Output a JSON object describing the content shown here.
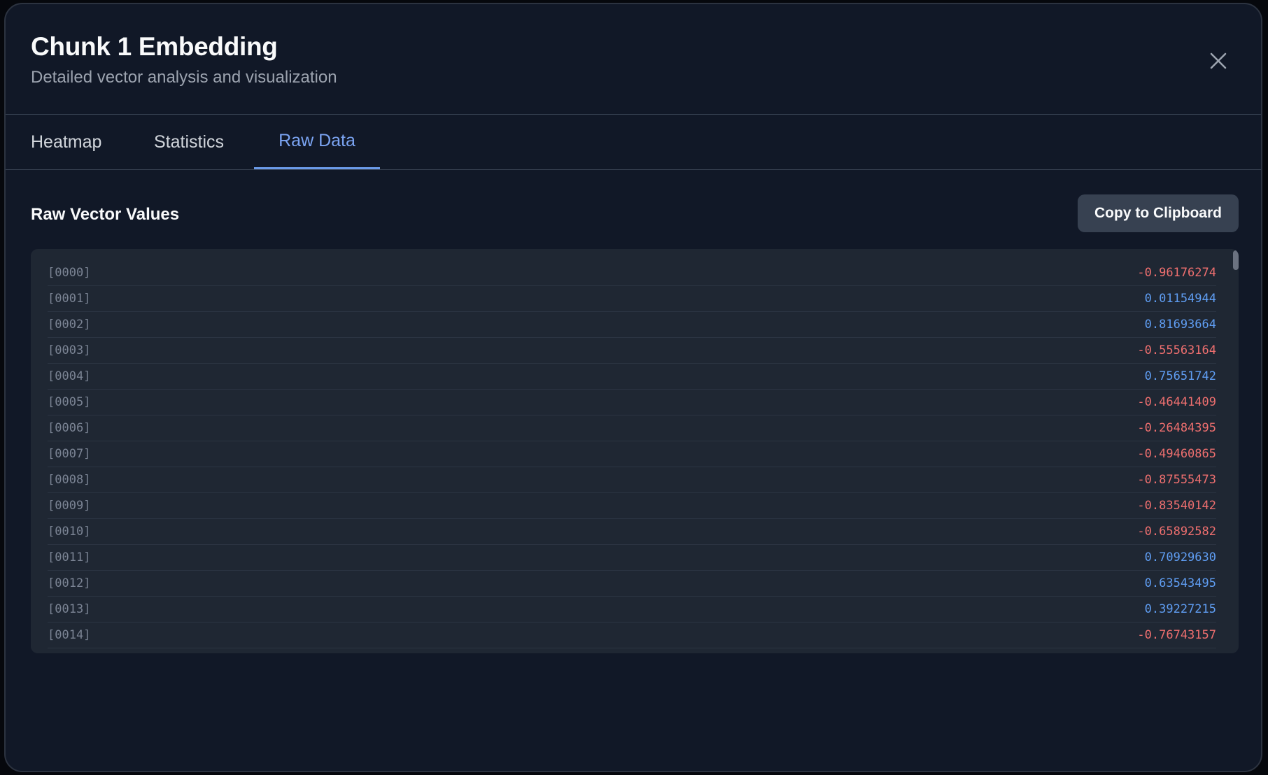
{
  "header": {
    "title": "Chunk 1 Embedding",
    "subtitle": "Detailed vector analysis and visualization",
    "close_icon": "close-icon"
  },
  "tabs": [
    {
      "label": "Heatmap",
      "active": false
    },
    {
      "label": "Statistics",
      "active": false
    },
    {
      "label": "Raw Data",
      "active": true
    }
  ],
  "raw_data": {
    "section_title": "Raw Vector Values",
    "copy_label": "Copy to Clipboard",
    "rows": [
      {
        "index": "[0000]",
        "value": "-0.96176274"
      },
      {
        "index": "[0001]",
        "value": "0.01154944"
      },
      {
        "index": "[0002]",
        "value": "0.81693664"
      },
      {
        "index": "[0003]",
        "value": "-0.55563164"
      },
      {
        "index": "[0004]",
        "value": "0.75651742"
      },
      {
        "index": "[0005]",
        "value": "-0.46441409"
      },
      {
        "index": "[0006]",
        "value": "-0.26484395"
      },
      {
        "index": "[0007]",
        "value": "-0.49460865"
      },
      {
        "index": "[0008]",
        "value": "-0.87555473"
      },
      {
        "index": "[0009]",
        "value": "-0.83540142"
      },
      {
        "index": "[0010]",
        "value": "-0.65892582"
      },
      {
        "index": "[0011]",
        "value": "0.70929630"
      },
      {
        "index": "[0012]",
        "value": "0.63543495"
      },
      {
        "index": "[0013]",
        "value": "0.39227215"
      },
      {
        "index": "[0014]",
        "value": "-0.76743157"
      }
    ]
  },
  "colors": {
    "positive": "#5f9df2",
    "negative": "#ee6f6f",
    "active_tab": "#7ba4f2",
    "background": "#111827"
  }
}
